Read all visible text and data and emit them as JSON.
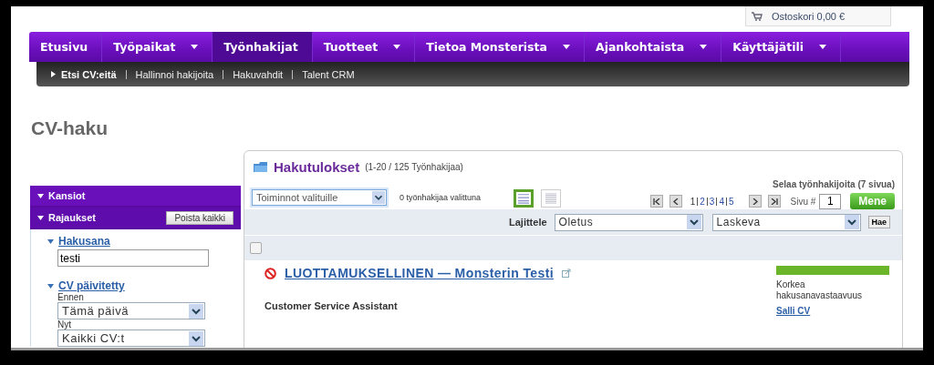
{
  "cart": {
    "text": "Ostoskori 0,00 €"
  },
  "nav": [
    {
      "label": "Etusivu",
      "selected": false,
      "dropdown": false
    },
    {
      "label": "Työpaikat",
      "selected": false,
      "dropdown": true
    },
    {
      "label": "Työnhakijat",
      "selected": true,
      "dropdown": false
    },
    {
      "label": "Tuotteet",
      "selected": false,
      "dropdown": true
    },
    {
      "label": "Tietoa Monsterista",
      "selected": false,
      "dropdown": true
    },
    {
      "label": "Ajankohtaista",
      "selected": false,
      "dropdown": true
    },
    {
      "label": "Käyttäjätili",
      "selected": false,
      "dropdown": true
    }
  ],
  "subnav": [
    {
      "label": "Etsi CV:eitä",
      "selected": true
    },
    {
      "label": "Hallinnoi hakijoita",
      "selected": false
    },
    {
      "label": "Hakuvahdit",
      "selected": false
    },
    {
      "label": "Talent CRM",
      "selected": false
    }
  ],
  "page_title": "CV-haku",
  "sidebar": {
    "folders_header": "Kansiot",
    "filters_header": "Rajaukset",
    "clear_button": "Poista kaikki",
    "keyword": {
      "label": "Hakusana",
      "value": "testi"
    },
    "updated": {
      "label": "CV päivitetty",
      "fields": [
        {
          "label": "Ennen",
          "value": "Tämä päivä"
        },
        {
          "label": "Nyt",
          "value": "Kaikki CV:t"
        }
      ]
    }
  },
  "results": {
    "title": "Hakutulokset",
    "count": "(1-20 / 125 Työnhakijaa)",
    "actions_select": "Toiminnot valituille",
    "selected_count": "0 työnhakijaa valittuna",
    "views": [
      {
        "kind": "list",
        "selected": true
      },
      {
        "kind": "compact",
        "selected": false
      }
    ],
    "browse_label": "Selaa työnhakijoita (7 sivua)",
    "pages": [
      {
        "label": "1",
        "selected": true
      },
      {
        "label": "2",
        "selected": false
      },
      {
        "label": "3",
        "selected": false
      },
      {
        "label": "4",
        "selected": false
      },
      {
        "label": "5",
        "selected": false
      }
    ],
    "page_label": "Sivu #",
    "page_value": "1",
    "go_button": "Mene",
    "sort_label": "Lajittele",
    "sort_field": "Oletus",
    "sort_order": "Laskeva",
    "sort_button": "Hae",
    "select_all_checked": false,
    "rows": [
      {
        "name": "LUOTTAMUKSELLINEN — Monsterin Testi",
        "title": "Customer Service Assistant",
        "relevance": {
          "level": 1,
          "label": "Korkea hakusanavastaavuus"
        },
        "link": "Salli CV"
      }
    ]
  }
}
